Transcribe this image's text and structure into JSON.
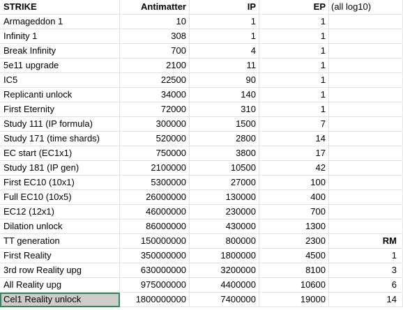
{
  "header": {
    "col0": "STRIKE",
    "col1": "Antimatter",
    "col2": "IP",
    "col3": "EP",
    "note": "(all log10)"
  },
  "rows": [
    {
      "name": "Armageddon 1",
      "am": "10",
      "ip": "1",
      "ep": "1",
      "rm": ""
    },
    {
      "name": "Infinity 1",
      "am": "308",
      "ip": "1",
      "ep": "1",
      "rm": ""
    },
    {
      "name": "Break Infinity",
      "am": "700",
      "ip": "4",
      "ep": "1",
      "rm": ""
    },
    {
      "name": "5e11 upgrade",
      "am": "2100",
      "ip": "11",
      "ep": "1",
      "rm": ""
    },
    {
      "name": "IC5",
      "am": "22500",
      "ip": "90",
      "ep": "1",
      "rm": ""
    },
    {
      "name": "Replicanti unlock",
      "am": "34000",
      "ip": "140",
      "ep": "1",
      "rm": ""
    },
    {
      "name": "First Eternity",
      "am": "72000",
      "ip": "310",
      "ep": "1",
      "rm": ""
    },
    {
      "name": "Study 111 (IP formula)",
      "am": "300000",
      "ip": "1500",
      "ep": "7",
      "rm": ""
    },
    {
      "name": "Study 171 (time shards)",
      "am": "520000",
      "ip": "2800",
      "ep": "14",
      "rm": ""
    },
    {
      "name": "EC start (EC1x1)",
      "am": "750000",
      "ip": "3800",
      "ep": "17",
      "rm": ""
    },
    {
      "name": "Study 181 (IP gen)",
      "am": "2100000",
      "ip": "10500",
      "ep": "42",
      "rm": ""
    },
    {
      "name": "First EC10 (10x1)",
      "am": "5300000",
      "ip": "27000",
      "ep": "100",
      "rm": ""
    },
    {
      "name": "Full EC10 (10x5)",
      "am": "26000000",
      "ip": "130000",
      "ep": "400",
      "rm": ""
    },
    {
      "name": "EC12 (12x1)",
      "am": "46000000",
      "ip": "230000",
      "ep": "700",
      "rm": ""
    },
    {
      "name": "Dilation unlock",
      "am": "86000000",
      "ip": "430000",
      "ep": "1300",
      "rm": ""
    },
    {
      "name": "TT generation",
      "am": "150000000",
      "ip": "800000",
      "ep": "2300",
      "rm": "RM"
    },
    {
      "name": "First Reality",
      "am": "350000000",
      "ip": "1800000",
      "ep": "4500",
      "rm": "1"
    },
    {
      "name": "3rd row Reality upg",
      "am": "630000000",
      "ip": "3200000",
      "ep": "8100",
      "rm": "3"
    },
    {
      "name": "All Reality upg",
      "am": "975000000",
      "ip": "4400000",
      "ep": "10600",
      "rm": "6"
    },
    {
      "name": "Cel1 Reality unlock",
      "am": "1800000000",
      "ip": "7400000",
      "ep": "19000",
      "rm": "14"
    }
  ]
}
